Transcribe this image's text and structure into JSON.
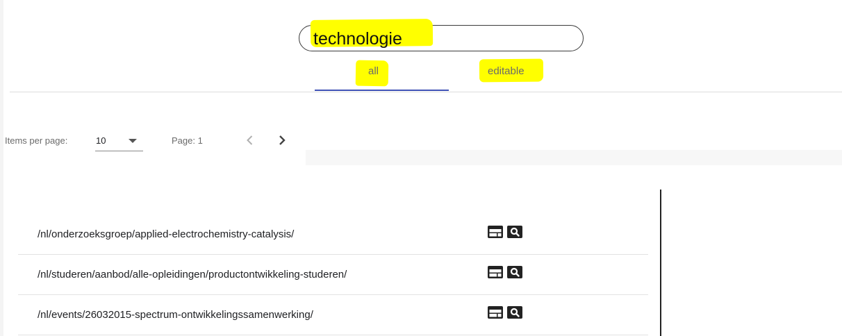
{
  "search": {
    "value": "technologie"
  },
  "tabs": [
    {
      "label": "all",
      "active": true
    },
    {
      "label": "editable",
      "active": false
    }
  ],
  "paginator": {
    "items_per_page_label": "Items per page:",
    "items_per_page_value": "10",
    "page_label": "Page: 1"
  },
  "colors": {
    "highlight": "#ffff00",
    "tab_indicator": "#3f51b5"
  },
  "results": [
    {
      "url": "/nl/onderzoeksgroep/applied-electrochemistry-catalysis/",
      "icons": [
        "layout-icon",
        "search-icon"
      ]
    },
    {
      "url": "/nl/studeren/aanbod/alle-opleidingen/productontwikkeling-studeren/",
      "icons": [
        "layout-icon",
        "search-icon"
      ]
    },
    {
      "url": "/nl/events/26032015-spectrum-ontwikkelingssamenwerking/",
      "icons": [
        "layout-icon",
        "search-icon"
      ]
    }
  ]
}
